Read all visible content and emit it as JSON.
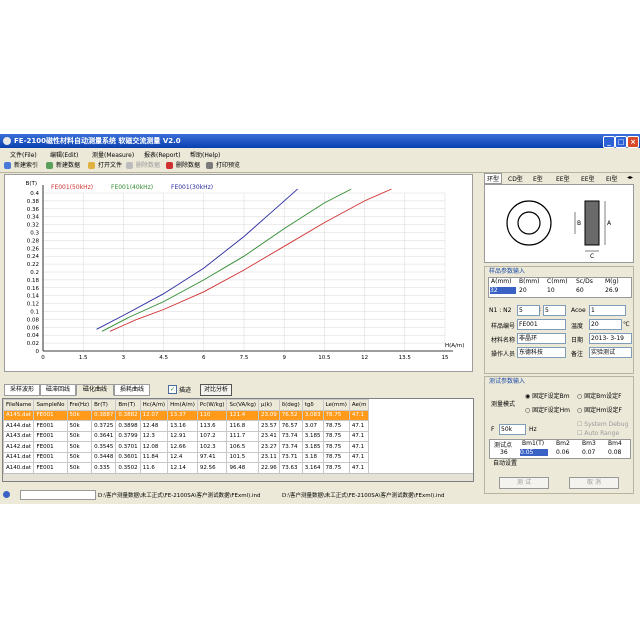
{
  "window": {
    "title": "FE-2100磁性材料自动测量系统 软磁交流测量 V2.0"
  },
  "menu": [
    "文件(File)",
    "编辑(Edit)",
    "测量(Measure)",
    "报表(Report)",
    "帮助(Help)"
  ],
  "toolbar": [
    "新建索引",
    "新建数据",
    "打开文件",
    "删除数据",
    "删除数据",
    "打印预览"
  ],
  "chart_data": {
    "type": "line",
    "ylabel": "B(T)",
    "xlabel": "H(A/m)",
    "y_ticks": [
      "0.4",
      "0.38",
      "0.36",
      "0.34",
      "0.32",
      "0.3",
      "0.28",
      "0.26",
      "0.24",
      "0.22",
      "0.2",
      "0.18",
      "0.16",
      "0.14",
      "0.12",
      "0.1",
      "0.08",
      "0.06",
      "0.04",
      "0.02",
      "0"
    ],
    "x_ticks": [
      "0",
      "1.5",
      "3",
      "4.5",
      "6",
      "7.5",
      "9",
      "10.5",
      "12",
      "13.5",
      "15"
    ],
    "ylim": [
      0,
      0.4
    ],
    "xlim": [
      0,
      15
    ],
    "series": [
      {
        "name": "FE001(50kHz)",
        "color": "#d03030",
        "x": [
          2.5,
          3.5,
          4.5,
          6.0,
          7.5,
          9.0,
          10.5,
          12.0,
          13.0
        ],
        "y": [
          0.05,
          0.08,
          0.105,
          0.15,
          0.205,
          0.265,
          0.325,
          0.38,
          0.41
        ]
      },
      {
        "name": "FE001(40kHz)",
        "color": "#2e8b2e",
        "x": [
          2.2,
          3.2,
          4.5,
          6.0,
          7.5,
          9.0,
          10.5,
          11.5
        ],
        "y": [
          0.05,
          0.085,
          0.125,
          0.18,
          0.24,
          0.31,
          0.375,
          0.41
        ]
      },
      {
        "name": "FE001(30kHz)",
        "color": "#2a2aa0",
        "x": [
          2.0,
          3.0,
          4.5,
          6.0,
          7.5,
          8.5,
          9.5
        ],
        "y": [
          0.055,
          0.09,
          0.145,
          0.21,
          0.29,
          0.35,
          0.41
        ]
      }
    ]
  },
  "bottom_tabs": [
    "采样波形",
    "磁滞回线",
    "磁化曲线",
    "损耗曲线"
  ],
  "trace_label": "描迹",
  "compare_label": "对比分析",
  "table": {
    "headers": [
      "FileName",
      "SampleNo",
      "Fre(Hz)",
      "Br(T)",
      "Bm(T)",
      "Hc(A/m)",
      "Hm(A/m)",
      "Pc(W/kg)",
      "Sc(VA/kg)",
      "μ(k)",
      "δ(deg)",
      "tgδ",
      "Le(mm)",
      "Ae(m"
    ],
    "rows": [
      [
        "A145.dat",
        "FE001",
        "50k",
        "0.3887",
        "0.3882",
        "12.07",
        "13.37",
        "110",
        "121.4",
        "23.09",
        "76.52",
        "3.083",
        "78.75",
        "47.1"
      ],
      [
        "A144.dat",
        "FE001",
        "50k",
        "0.3725",
        "0.3898",
        "12.48",
        "13.16",
        "113.6",
        "116.8",
        "23.57",
        "76.57",
        "3.07",
        "78.75",
        "47.1"
      ],
      [
        "A143.dat",
        "FE001",
        "50k",
        "0.3641",
        "0.3799",
        "12.3",
        "12.91",
        "107.2",
        "111.7",
        "23.41",
        "73.74",
        "3.185",
        "78.75",
        "47.1"
      ],
      [
        "A142.dat",
        "FE001",
        "50k",
        "0.3545",
        "0.3701",
        "12.08",
        "12.66",
        "102.3",
        "106.5",
        "23.27",
        "73.74",
        "3.185",
        "78.75",
        "47.1"
      ],
      [
        "A141.dat",
        "FE001",
        "50k",
        "0.3448",
        "0.3601",
        "11.84",
        "12.4",
        "97.41",
        "101.5",
        "23.11",
        "73.71",
        "3.18",
        "78.75",
        "47.1"
      ],
      [
        "A140.dat",
        "FE001",
        "50k",
        "0.335",
        "0.3502",
        "11.6",
        "12.14",
        "92.56",
        "96.48",
        "22.96",
        "73.63",
        "3.164",
        "78.75",
        "47.1"
      ]
    ]
  },
  "shape_tabs": [
    "环型",
    "CD型",
    "E型",
    "EE型",
    "EE型",
    "EI型"
  ],
  "sample_params": {
    "title": "样品参数输入",
    "headers": [
      "A(mm)",
      "B(mm)",
      "C(mm)",
      "Sc/Ds",
      "M(g)"
    ],
    "values": [
      "32",
      "20",
      "10",
      "60",
      "26.9"
    ],
    "n1_label": "N1 : N2",
    "n1": "5",
    "n2": "5",
    "acoe_label": "Acoe",
    "acoe": "1",
    "sample_no_label": "样品编号",
    "sample_no": "FE001",
    "temp_label": "温度",
    "temp": "20",
    "temp_unit": "℃",
    "material_label": "材料名称",
    "material": "非晶环",
    "date_label": "日期",
    "date": "2013- 3-19",
    "operator_label": "操作人员",
    "operator": "东德科技",
    "note_label": "备注",
    "note": "实验测试"
  },
  "test_params": {
    "title": "测试参数输入",
    "mode_label": "测量模式",
    "modes": [
      "固定F设定Bm",
      "固定Bm设定F",
      "固定F设定Hm",
      "固定Hm设定F"
    ],
    "freq_label": "F",
    "freq": "50k",
    "freq_unit": "Hz",
    "sys_debug": "System Debug",
    "auto_range": "Auto Range",
    "count_headers": [
      "测试点",
      "Bm1(T)",
      "Bm2",
      "Bm3",
      "Bm4"
    ],
    "count_values": [
      "36",
      "0.05",
      "0.06",
      "0.07",
      "0.08"
    ],
    "auto_set_label": "自动设置",
    "test_button": "测 试",
    "cancel_button": "取 消"
  },
  "status": [
    "D:\\客户测量数据\\未工正式\\FE-2100SA\\客户测试数据\\FExml).ind",
    "D:\\客户测量数据\\未工正式\\FE-2100SA\\客户测试数据\\FExml).ind"
  ]
}
